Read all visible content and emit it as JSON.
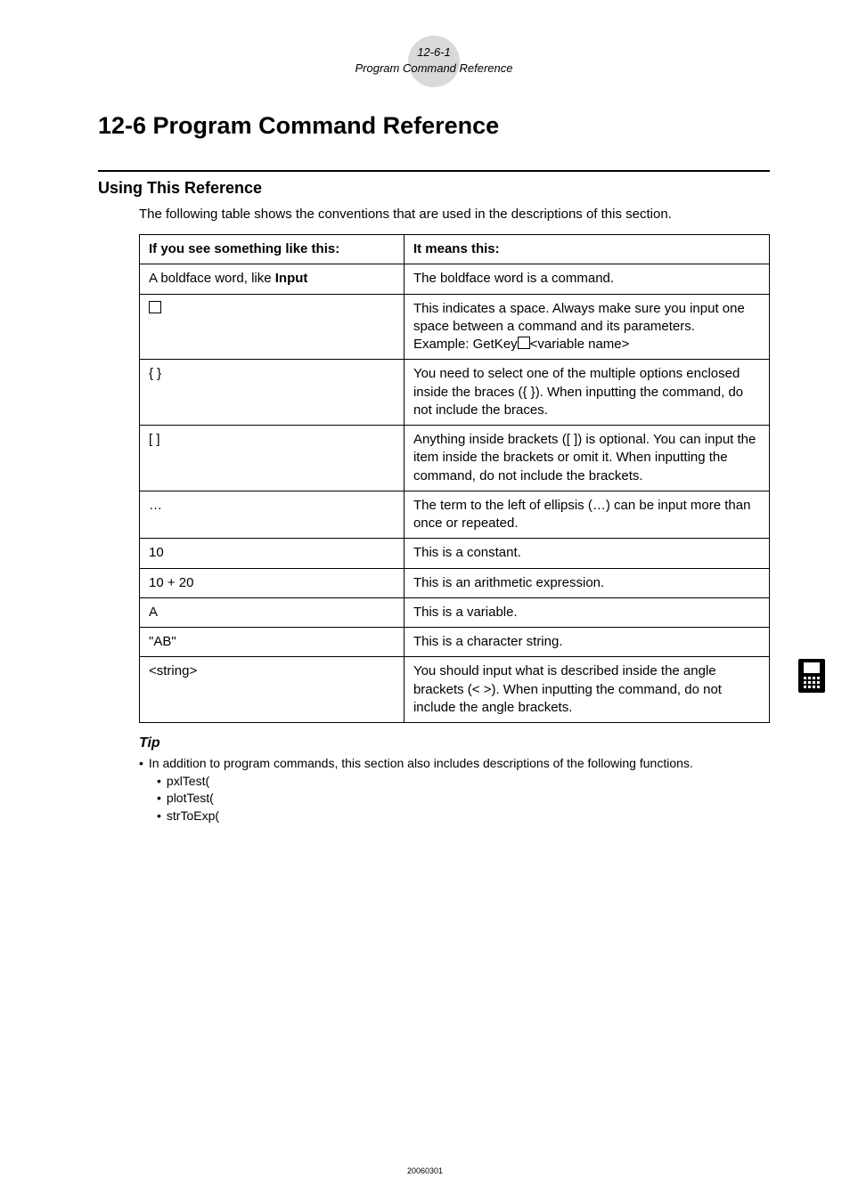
{
  "header": {
    "pageref": "12-6-1",
    "headertitle": "Program Command Reference"
  },
  "title": "12-6  Program Command Reference",
  "subhead": "Using This Reference",
  "intro": "The following table shows the conventions that are used in the descriptions of this section.",
  "table": {
    "head_left": "If you see something like this:",
    "head_right": "It means this:",
    "rows": [
      {
        "left_html": "A boldface word, like <b>Input</b>",
        "right": "The boldface word is a command."
      },
      {
        "left_html": "<span class='square-glyph'></span>",
        "right_html": "This indicates a space. Always make sure you input one space between a command and its parameters.<br>Example: GetKey<span class='square-glyph'></span>&lt;variable name&gt;"
      },
      {
        "left": "{  }",
        "right": "You need to select one of the multiple options enclosed inside the braces ({ }). When inputting the command, do not include the braces."
      },
      {
        "left": "[   ]",
        "right": "Anything inside brackets ([ ]) is optional. You can input the item inside the brackets or omit it. When inputting the command, do not include the brackets."
      },
      {
        "left": "…",
        "right": "The term to the left of ellipsis (…) can be input more than once or repeated."
      },
      {
        "left": "10",
        "right": "This is a constant."
      },
      {
        "left": "10 + 20",
        "right": "This is an arithmetic expression."
      },
      {
        "left": "A",
        "right": "This is a variable."
      },
      {
        "left": "\"AB\"",
        "right": "This is a character string."
      },
      {
        "left": "<string>",
        "right": "You should input what is described inside the angle brackets (< >). When inputting the command, do not include the angle brackets."
      }
    ]
  },
  "tip": {
    "heading": "Tip",
    "main": "In addition to program commands, this section also includes descriptions of the following functions.",
    "items": [
      "pxlTest(",
      "plotTest(",
      "strToExp("
    ]
  },
  "footer": "20060301"
}
